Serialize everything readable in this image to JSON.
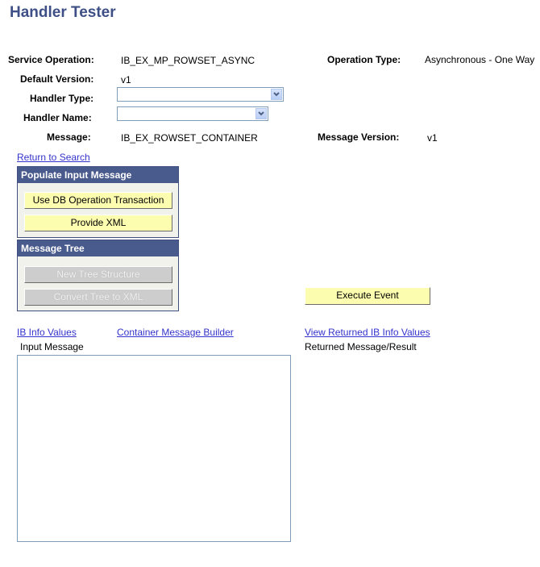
{
  "page": {
    "title": "Handler Tester"
  },
  "fields": {
    "service_operation": {
      "label": "Service Operation:",
      "value": "IB_EX_MP_ROWSET_ASYNC"
    },
    "operation_type": {
      "label": "Operation Type:",
      "value": "Asynchronous - One Way"
    },
    "default_version": {
      "label": "Default Version:",
      "value": "v1"
    },
    "handler_type": {
      "label": "Handler Type:",
      "value": ""
    },
    "handler_name": {
      "label": "Handler Name:",
      "value": ""
    },
    "message": {
      "label": "Message:",
      "value": "IB_EX_ROWSET_CONTAINER"
    },
    "message_version": {
      "label": "Message Version:",
      "value": "v1"
    }
  },
  "links": {
    "return_to_search": "Return to Search",
    "ib_info_values": "IB Info Values",
    "container_message_builder": "Container Message Builder",
    "view_returned_ib_info_values": "View Returned IB Info Values"
  },
  "populate_group": {
    "header": "Populate Input Message",
    "use_db_button": "Use DB Operation Transaction",
    "provide_xml_button": "Provide XML"
  },
  "tree_group": {
    "header": "Message Tree",
    "new_tree_button": "New Tree Structure",
    "convert_tree_button": "Convert Tree to XML"
  },
  "execute_button": "Execute Event",
  "input_message": {
    "label": "Input Message",
    "value": ""
  },
  "returned_message": {
    "label": "Returned Message/Result"
  }
}
